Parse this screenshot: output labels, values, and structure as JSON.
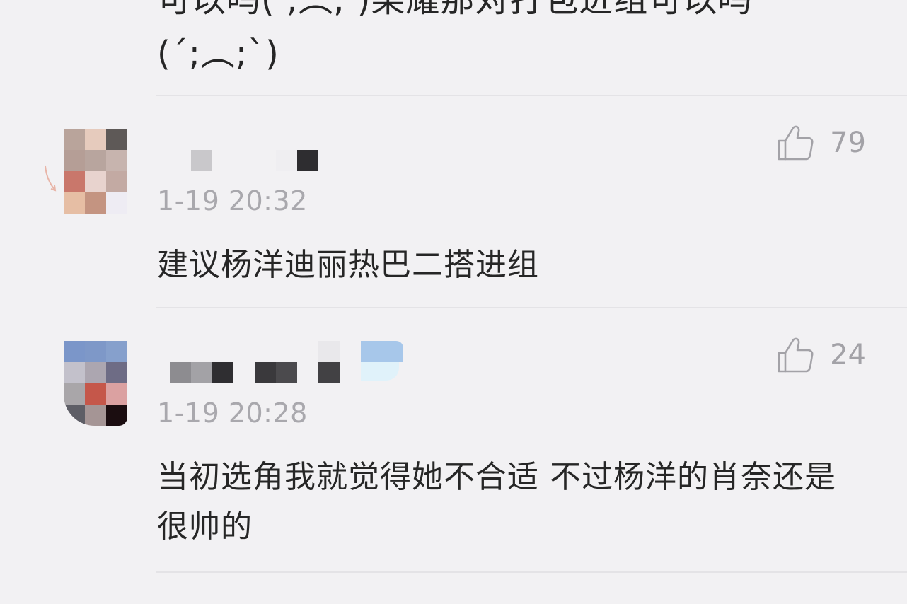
{
  "top_comment": {
    "line1": "可以吗( ;︵; )某耀那对打包进组可以吗",
    "line2": "(´;︵;`)"
  },
  "comments": [
    {
      "timestamp": "1-19 20:32",
      "text": "建议杨洋迪丽热巴二搭进组",
      "like_count": "79"
    },
    {
      "timestamp": "1-19 20:28",
      "text": "当初选角我就觉得她不合适 不过杨洋的肖奈还是很帅的",
      "like_count": "24"
    }
  ],
  "icons": {
    "like": "thumbs-up-icon"
  },
  "colors": {
    "background": "#f2f1f3",
    "timestamp": "#a9a8ad",
    "like_icon": "#a3a2a7"
  }
}
